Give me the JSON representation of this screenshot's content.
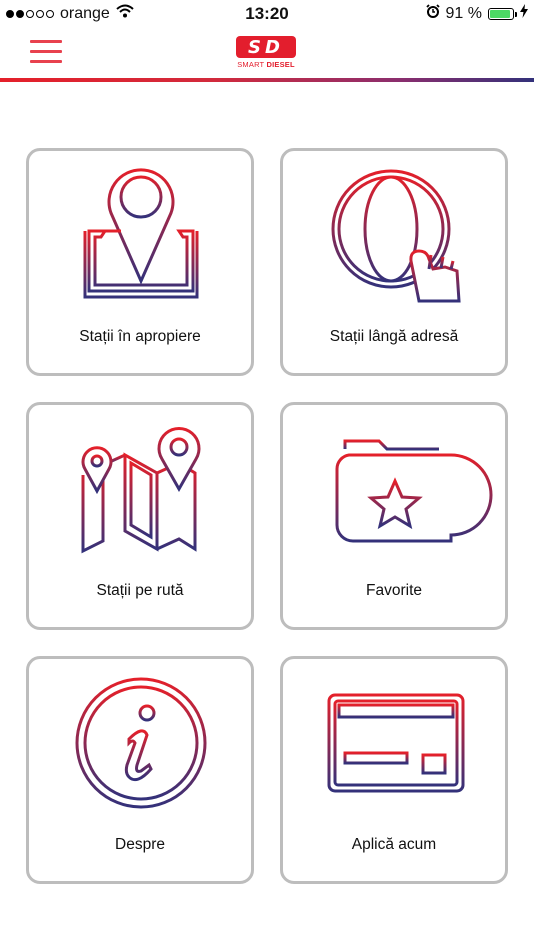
{
  "status_bar": {
    "carrier": "orange",
    "time": "13:20",
    "battery_percent": "91 %",
    "battery_level": 0.91
  },
  "header": {
    "logo_mark": "SD",
    "logo_text_a": "SMART ",
    "logo_text_b": "DIESEL"
  },
  "colors": {
    "accent_red": "#e4202a",
    "accent_blue": "#33317a",
    "card_border": "#bdbdbd"
  },
  "menu": [
    {
      "label": "Stații în apropiere",
      "icon": "map-pin-icon"
    },
    {
      "label": "Stații lângă adresă",
      "icon": "globe-hand-icon"
    },
    {
      "label": "Stații pe rută",
      "icon": "route-map-icon"
    },
    {
      "label": "Favorite",
      "icon": "star-folder-icon"
    },
    {
      "label": "Despre",
      "icon": "info-icon"
    },
    {
      "label": "Aplică acum",
      "icon": "card-icon"
    }
  ]
}
